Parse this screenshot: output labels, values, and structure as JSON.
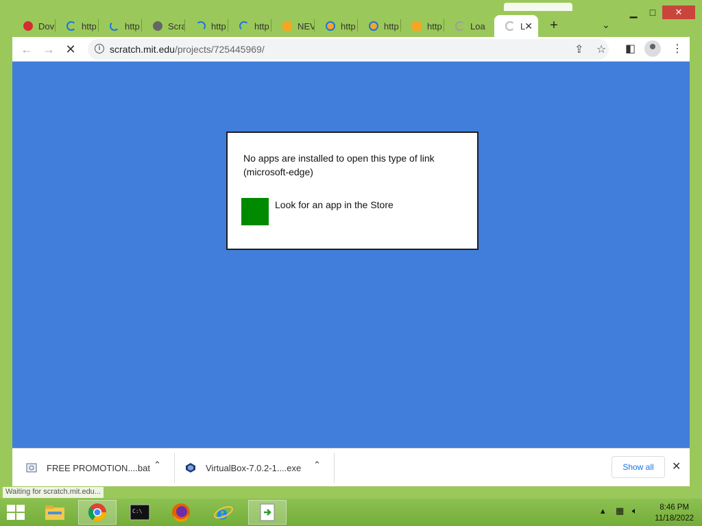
{
  "browser": {
    "tabs": [
      {
        "label": "Dov",
        "icon": "mega-icon",
        "color": "#d32f2f"
      },
      {
        "label": "http",
        "icon": "loading-spinner-icon",
        "color": "#1a73e8"
      },
      {
        "label": "http",
        "icon": "loading-spinner-icon",
        "color": "#1a73e8"
      },
      {
        "label": "Scra",
        "icon": "globe-icon",
        "color": "#555555"
      },
      {
        "label": "http",
        "icon": "loading-spinner-icon",
        "color": "#1a73e8"
      },
      {
        "label": "http",
        "icon": "loading-spinner-icon",
        "color": "#1a73e8"
      },
      {
        "label": "NEV",
        "icon": "scratch-cat-icon",
        "color": "#f5a623"
      },
      {
        "label": "http",
        "icon": "scratch-cat-icon",
        "color": "#f5a623"
      },
      {
        "label": "http",
        "icon": "scratch-cat-icon",
        "color": "#1a73e8"
      },
      {
        "label": "http",
        "icon": "scratch-cat-icon",
        "color": "#f5a623"
      },
      {
        "label": "Loa",
        "icon": "loading-spinner-icon",
        "color": "#9e9e9e"
      }
    ],
    "active_tab": {
      "label": "L",
      "close": "✕"
    },
    "new_tab": "+",
    "tab_search": "⌄",
    "url_domain": "scratch.mit.edu",
    "url_path": "/projects/725445969/"
  },
  "dialog": {
    "message": "No apps are installed to open this type of link (microsoft-edge)",
    "store_link": "Look for an app in the Store"
  },
  "downloads": {
    "items": [
      {
        "name": "FREE PROMOTION....bat",
        "icon": "bat-file-icon"
      },
      {
        "name": "VirtualBox-7.0.2-1....exe",
        "icon": "virtualbox-icon"
      }
    ],
    "show_all": "Show all",
    "close": "✕"
  },
  "status_text": "Waiting for scratch.mit.edu...",
  "taskbar": {
    "time": "8:46 PM",
    "date": "11/18/2022"
  }
}
